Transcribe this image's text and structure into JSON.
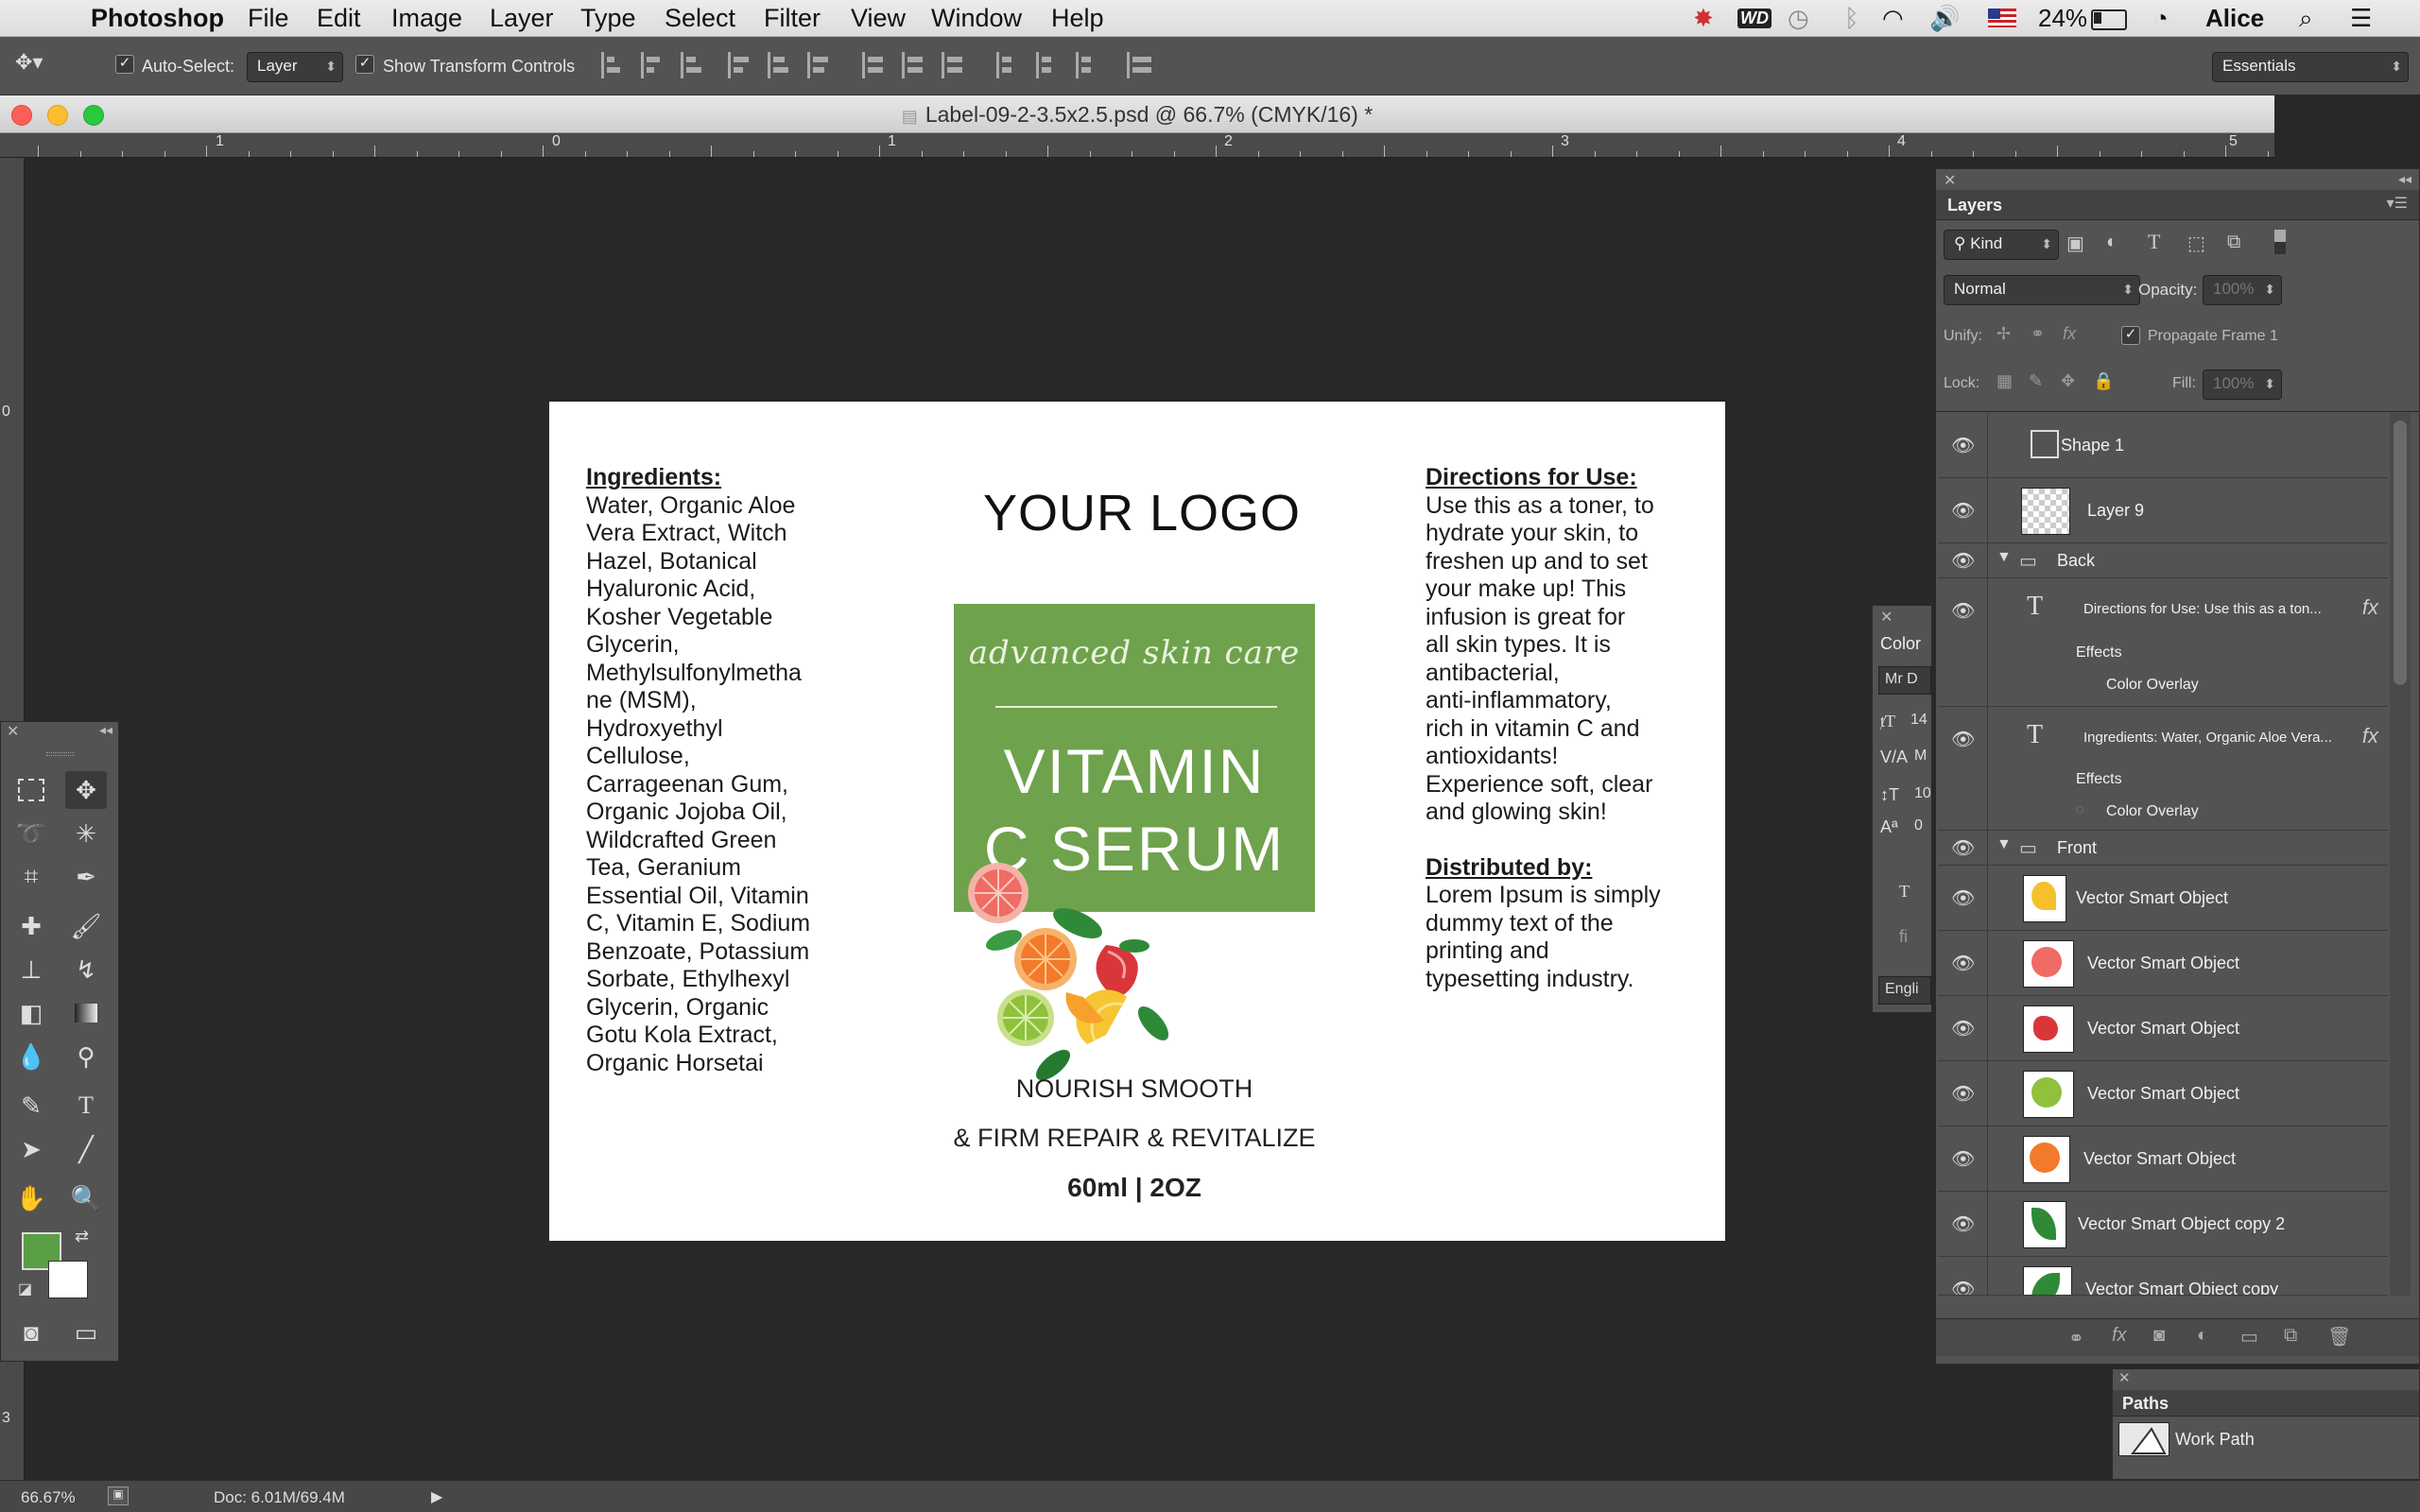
{
  "menubar": {
    "app": "Photoshop",
    "items": [
      "File",
      "Edit",
      "Image",
      "Layer",
      "Type",
      "Select",
      "Filter",
      "View",
      "Window",
      "Help"
    ],
    "battery": "24%",
    "user": "Alice"
  },
  "options": {
    "auto_select_label": "Auto-Select:",
    "auto_select_value": "Layer",
    "transform_label": "Show Transform Controls",
    "workspace": "Essentials"
  },
  "document": {
    "title": "Label-09-2-3.5x2.5.psd @ 66.7% (CMYK/16) *",
    "ruler_h": [
      "1",
      "0",
      "1",
      "2",
      "3",
      "4",
      "5"
    ],
    "ruler_v": [
      "0",
      "3"
    ]
  },
  "label": {
    "ingredients_heading": "Ingredients:",
    "ingredients_lines": [
      "Water, Organic Aloe",
      "Vera Extract, Witch",
      "Hazel, Botanical",
      "Hyaluronic Acid,",
      "Kosher Vegetable",
      "Glycerin,",
      "Methylsulfonylmetha",
      "ne (MSM),",
      "Hydroxyethyl",
      "Cellulose,",
      "Carrageenan Gum,",
      "Organic Jojoba Oil,",
      "Wildcrafted Green",
      "Tea, Geranium",
      "Essential Oil, Vitamin",
      "C, Vitamin E, Sodium",
      "Benzoate, Potassium",
      "Sorbate, Ethylhexyl",
      "Glycerin, Organic",
      "Gotu Kola Extract,",
      "Organic Horsetai"
    ],
    "logo": "YOUR LOGO",
    "tagline": "advanced skin care",
    "product_line1": "VITAMIN",
    "product_line2": "C SERUM",
    "benefit1": "NOURISH SMOOTH",
    "benefit2": "& FIRM REPAIR & REVITALIZE",
    "size": "60ml  |  2OZ",
    "directions_heading": "Directions for Use:",
    "directions_lines": [
      "Use this as a toner, to",
      "hydrate your skin, to",
      "freshen up and to set",
      "your make up! This",
      "infusion is great for",
      "all skin types. It is",
      "antibacterial,",
      "anti-inflammatory,",
      "rich in vitamin C and",
      "antioxidants!",
      "Experience soft, clear",
      "and glowing skin!"
    ],
    "distributed_heading": "Distributed by:",
    "distributed_lines": [
      "Lorem Ipsum is simply",
      "dummy text of the",
      "printing and",
      "typesetting industry."
    ],
    "green": "#6fa24c"
  },
  "color_panel": {
    "tab": "Color",
    "font": "Mr D",
    "size1": "14",
    "kern": "M",
    "size2": "10",
    "size3": "0",
    "lang": "Engli"
  },
  "layers_panel": {
    "tab": "Layers",
    "filter": "Kind",
    "blend_mode": "Normal",
    "opacity_label": "Opacity:",
    "opacity_value": "100%",
    "unify_label": "Unify:",
    "propagate_label": "Propagate Frame 1",
    "lock_label": "Lock:",
    "fill_label": "Fill:",
    "fill_value": "100%",
    "rows": {
      "shape1": "Shape 1",
      "layer9": "Layer 9",
      "back": "Back",
      "text_directions": "Directions for Use:  Use this as a ton...",
      "effects": "Effects",
      "color_overlay": "Color Overlay",
      "text_ingredients": "Ingredients: Water, Organic Aloe Vera...",
      "front": "Front",
      "vso": "Vector Smart Object",
      "vso_copy2": "Vector Smart Object copy 2",
      "vso_copy": "Vector Smart Object copy"
    }
  },
  "paths_panel": {
    "tab": "Paths",
    "item": "Work Path"
  },
  "status": {
    "zoom": "66.67%",
    "doc": "Doc: 6.01M/69.4M"
  },
  "foreground_color": "#5a9e46",
  "background_color": "#ffffff"
}
